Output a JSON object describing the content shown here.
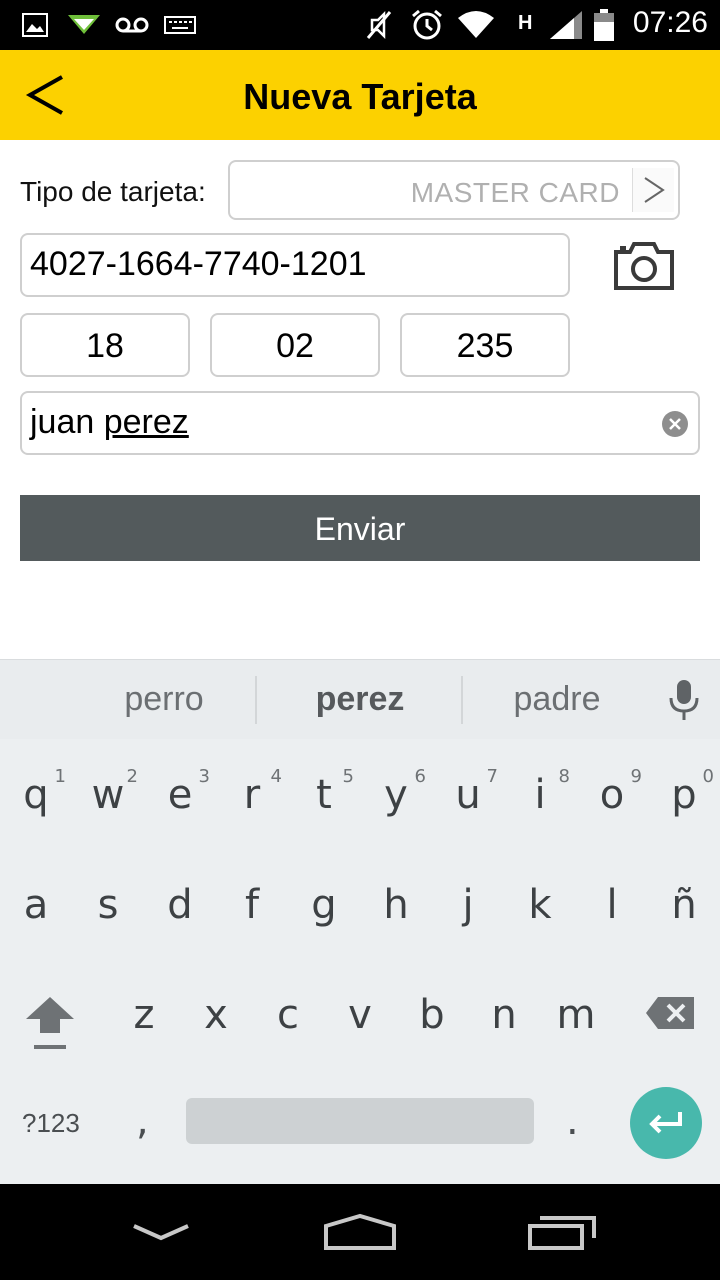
{
  "status_bar": {
    "time": "07:26",
    "icons": [
      "picture-icon",
      "send-notification-icon",
      "voicemail-icon",
      "keyboard-icon",
      "mute-icon",
      "alarm-icon",
      "wifi-icon",
      "network-h-icon",
      "signal-icon",
      "battery-icon"
    ],
    "network_type": "H"
  },
  "app_bar": {
    "title": "Nueva Tarjeta",
    "background": "#fcd100"
  },
  "form": {
    "card_type_label": "Tipo de tarjeta:",
    "card_type_value": "MASTER CARD",
    "card_number": "4027-1664-7740-1201",
    "expiry_month": "18",
    "expiry_year": "02",
    "cvv": "235",
    "name_first": "juan",
    "name_last": "perez",
    "submit_label": "Enviar",
    "submit_color": "#535a5c"
  },
  "keyboard": {
    "suggestions": [
      "perro",
      "perez",
      "padre"
    ],
    "row1": [
      {
        "k": "q",
        "n": "1"
      },
      {
        "k": "w",
        "n": "2"
      },
      {
        "k": "e",
        "n": "3"
      },
      {
        "k": "r",
        "n": "4"
      },
      {
        "k": "t",
        "n": "5"
      },
      {
        "k": "y",
        "n": "6"
      },
      {
        "k": "u",
        "n": "7"
      },
      {
        "k": "i",
        "n": "8"
      },
      {
        "k": "o",
        "n": "9"
      },
      {
        "k": "p",
        "n": "0"
      }
    ],
    "row2": [
      "a",
      "s",
      "d",
      "f",
      "g",
      "h",
      "j",
      "k",
      "l",
      "ñ"
    ],
    "row3": [
      "z",
      "x",
      "c",
      "v",
      "b",
      "n",
      "m"
    ],
    "symbols_label": "?123",
    "comma": ",",
    "period": ".",
    "enter_color": "#48b8ac"
  }
}
